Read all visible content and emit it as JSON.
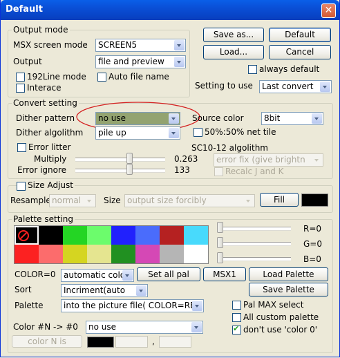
{
  "window": {
    "title": "Default"
  },
  "output_mode": {
    "group_label": "Output mode",
    "screen_label": "MSX screen mode",
    "screen_value": "SCREEN5",
    "output_label": "Output",
    "output_value": "file and preview",
    "line192_label": "192Line mode",
    "interlace_label": "Interace",
    "auto_file_label": "Auto file name"
  },
  "buttons": {
    "save_as": "Save as...",
    "default": "Default",
    "load": "Load...",
    "cancel": "Cancel",
    "fill": "Fill",
    "set_all_pal": "Set all pal",
    "msx1": "MSX1",
    "load_palette": "Load Palette",
    "save_palette": "Save Palette",
    "color_n_is": "color N is"
  },
  "always_default_label": "always default",
  "setting_to_use": {
    "label": "Setting to use",
    "value": "Last convert"
  },
  "convert": {
    "group_label": "Convert setting",
    "dither_pattern_label": "Dither pattern",
    "dither_pattern_value": "no use",
    "source_color_label": "Source color",
    "source_color_value": "8bit",
    "dither_algorithm_label": "Dither algolithm",
    "dither_algorithm_value": "pile up",
    "net_tile_label": "50%:50% net tile",
    "error_litter_label": "Error litter",
    "sc10_label": "SC10-12 algolithm",
    "sc10_value": "error fix (give brightn",
    "multiply_label": "Multiply",
    "multiply_value": "0.263",
    "error_ignore_label": "Error ignore",
    "error_ignore_value": "133",
    "recalc_label": "Recalc J and K",
    "multiply_level": 0.6,
    "error_ignore_level": 0.6
  },
  "size": {
    "size_adjust_label": "Size Adjust",
    "resample_label": "Resample",
    "resample_value": "normal",
    "size_label": "Size",
    "size_value": "output size forcibly",
    "fill_color": "#000000"
  },
  "palette": {
    "group_label": "Palette setting",
    "colors_row1": [
      "#000000",
      "#000000",
      "#24d524",
      "#6cfc6c",
      "#2121fd",
      "#4a6cfc",
      "#b52121",
      "#48dafc"
    ],
    "colors_row2": [
      "#fc2121",
      "#fc6c6c",
      "#d5d521",
      "#e5e590",
      "#219021",
      "#d548b5",
      "#b5b5b5",
      "#ffffff"
    ],
    "r_label": "R=0",
    "g_label": "G=0",
    "b_label": "B=0",
    "color_label": "COLOR=0",
    "color_mode_value": "automatic colo",
    "sort_label": "Sort",
    "sort_value": "Incriment(auto only)",
    "palette_label": "Palette",
    "palette_value": "into the picture file( COLOR=RE",
    "color_n_label": "Color #N -> #0",
    "color_n_value": "no use",
    "pal_max_label": "Pal MAX select",
    "all_custom_label": "All custom palette",
    "dont_use_label": "don't use 'color 0'",
    "coord_sep": ","
  }
}
